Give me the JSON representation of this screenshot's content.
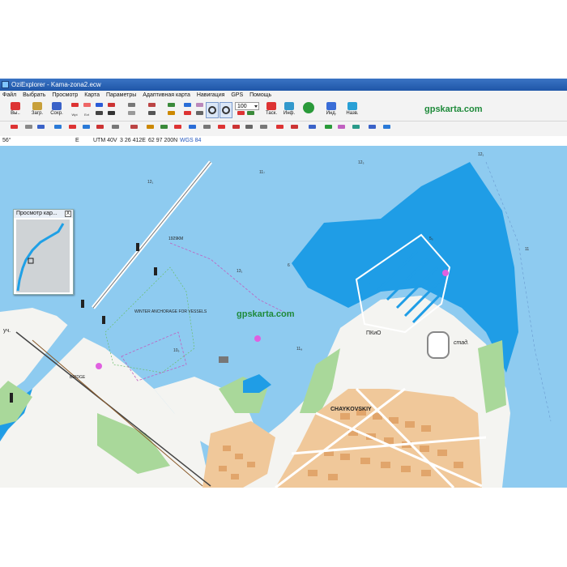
{
  "window": {
    "title": "OziExplorer - Kama-zona2.ecw"
  },
  "menu": [
    "Файл",
    "Выбрать",
    "Просмотр",
    "Карта",
    "Параметры",
    "Адаптивная карта",
    "Навигация",
    "GPS",
    "Помощь"
  ],
  "toolbar": {
    "btn_exit": "Вы..",
    "btn_load": "Загр.",
    "btn_save": "Сохр.",
    "small1": "Wpt",
    "small2": "Evt",
    "zoom": "100",
    "btn_task": "Таск.",
    "btn_info": "Инф.",
    "btn_index": "Инд.",
    "btn_back": "Назв.",
    "brand": "gpskarta.com"
  },
  "status": {
    "lat": "56°",
    "e": "E",
    "utm": "UTM  40V",
    "east": "3 26 412E",
    "north": "62 97 200N",
    "datum": "WGS 84"
  },
  "overview": {
    "title": "Просмотр кар...",
    "close": "X"
  },
  "map": {
    "watermark": "gpskarta.com",
    "anchorage": "WINTER ANCHORAGE FOR VESSELS",
    "city": "CHAYKOVSKIY",
    "pkio": "ПКиО",
    "stad": "стад.",
    "uch": "уч.",
    "bridge": "BRIDGE",
    "km": "1929КМ",
    "depths": [
      "12₁",
      "11₇",
      "12₃",
      "12₁",
      "13₁",
      "10₉",
      "11₈",
      "11",
      "5₅",
      "6"
    ]
  },
  "colors": {
    "water": "#8ecbf0",
    "deep": "#1f9de6",
    "land": "#f6f6f3",
    "green": "#a9d89a",
    "urban": "#f0c89a",
    "brand": "#1e8a3a"
  }
}
